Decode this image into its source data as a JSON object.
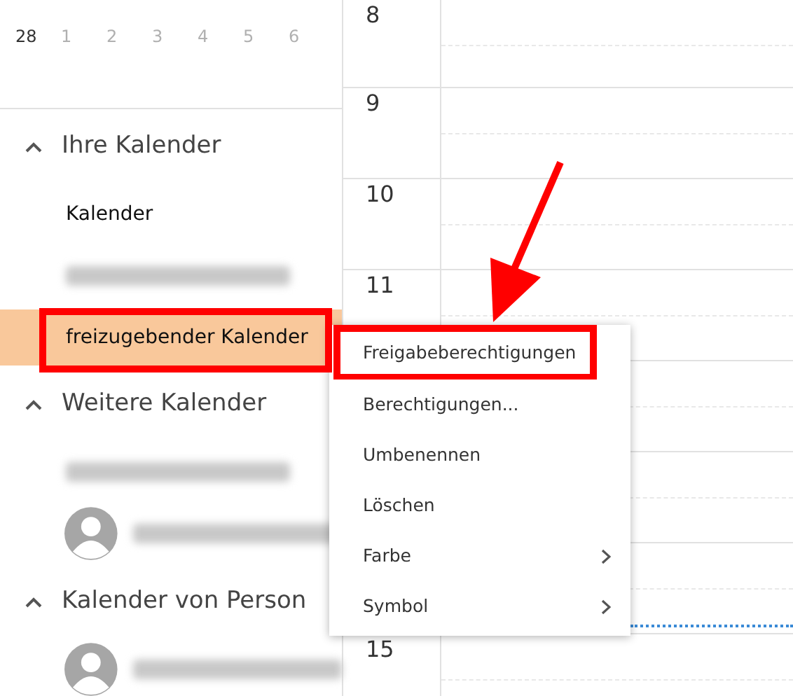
{
  "mini_calendar": {
    "days": [
      {
        "label": "28",
        "other_month": false
      },
      {
        "label": "1",
        "other_month": true
      },
      {
        "label": "2",
        "other_month": true
      },
      {
        "label": "3",
        "other_month": true
      },
      {
        "label": "4",
        "other_month": true
      },
      {
        "label": "5",
        "other_month": true
      },
      {
        "label": "6",
        "other_month": true
      }
    ]
  },
  "sidebar": {
    "groups": [
      {
        "title": "Ihre Kalender",
        "expanded": true,
        "items": [
          {
            "kind": "text",
            "label": "Kalender",
            "selected": false
          },
          {
            "kind": "redacted",
            "selected": false
          },
          {
            "kind": "text",
            "label": "freizugebender Kalender",
            "selected": true
          }
        ]
      },
      {
        "title": "Weitere Kalender",
        "expanded": true,
        "items": [
          {
            "kind": "redacted",
            "selected": false
          },
          {
            "kind": "avatar-redacted",
            "selected": false
          }
        ]
      },
      {
        "title": "Kalender von Person",
        "expanded": true,
        "items": [
          {
            "kind": "avatar-redacted",
            "selected": false
          }
        ]
      }
    ]
  },
  "day_view": {
    "hours": [
      {
        "label": "8"
      },
      {
        "label": "9"
      },
      {
        "label": "10"
      },
      {
        "label": "11"
      },
      {
        "label": "15"
      }
    ]
  },
  "context_menu": {
    "items": [
      {
        "label": "Freigabeberechtigungen",
        "submenu": false,
        "annotated": true
      },
      {
        "label": "Berechtigungen...",
        "submenu": false
      },
      {
        "label": "Umbenennen",
        "submenu": false
      },
      {
        "label": "Löschen",
        "submenu": false
      },
      {
        "label": "Farbe",
        "submenu": true
      },
      {
        "label": "Symbol",
        "submenu": true
      }
    ]
  }
}
